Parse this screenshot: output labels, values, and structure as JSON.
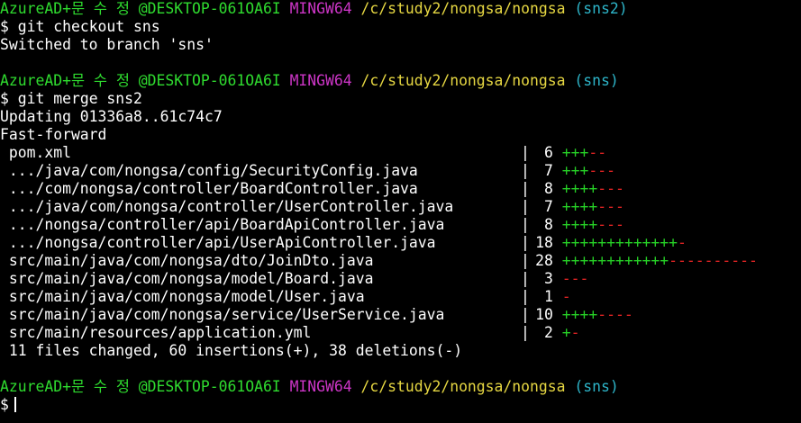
{
  "colors": {
    "user": "#2fdc2f",
    "env": "#cc35c6",
    "path": "#e6d742",
    "branch": "#2db5c9",
    "plus": "#26d026",
    "minus": "#e02424"
  },
  "prompt": {
    "user": "AzureAD+문 수 정 @DESKTOP-061OA6I",
    "env": "MINGW64",
    "path": "/c/study2/nongsa/nongsa",
    "symbol": "$"
  },
  "blocks": [
    {
      "branch": "(sns2)",
      "command": "git checkout sns",
      "output": [
        "Switched to branch 'sns'"
      ]
    },
    {
      "branch": "(sns)",
      "command": "git merge sns2",
      "output": [
        "Updating 01336a8..61c74c7",
        "Fast-forward"
      ]
    }
  ],
  "diffstat": [
    {
      "file": " pom.xml",
      "count": "6",
      "plus": "+++",
      "minus": "--"
    },
    {
      "file": " .../java/com/nongsa/config/SecurityConfig.java",
      "count": "7",
      "plus": "+++",
      "minus": "---"
    },
    {
      "file": " .../com/nongsa/controller/BoardController.java",
      "count": "8",
      "plus": "++++",
      "minus": "---"
    },
    {
      "file": " .../java/com/nongsa/controller/UserController.java",
      "count": "7",
      "plus": "++++",
      "minus": "---"
    },
    {
      "file": " .../nongsa/controller/api/BoardApiController.java",
      "count": "8",
      "plus": "++++",
      "minus": "---"
    },
    {
      "file": " .../nongsa/controller/api/UserApiController.java",
      "count": "18",
      "plus": "+++++++++++++",
      "minus": "-"
    },
    {
      "file": " src/main/java/com/nongsa/dto/JoinDto.java",
      "count": "28",
      "plus": "++++++++++++",
      "minus": "----------"
    },
    {
      "file": " src/main/java/com/nongsa/model/Board.java",
      "count": "3",
      "plus": "",
      "minus": "---"
    },
    {
      "file": " src/main/java/com/nongsa/model/User.java",
      "count": "1",
      "plus": "",
      "minus": "-"
    },
    {
      "file": " src/main/java/com/nongsa/service/UserService.java",
      "count": "10",
      "plus": "++++",
      "minus": "----"
    },
    {
      "file": " src/main/resources/application.yml",
      "count": "2",
      "plus": "+",
      "minus": "-"
    }
  ],
  "summary": " 11 files changed, 60 insertions(+), 38 deletions(-)",
  "final_prompt": {
    "branch": "(sns)"
  },
  "icons": {
    "cursor": "text-cursor-icon"
  }
}
